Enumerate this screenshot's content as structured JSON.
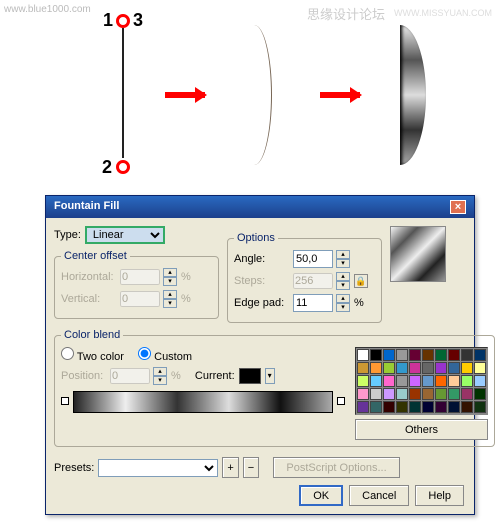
{
  "watermarks": {
    "left": "www.blue1000.com",
    "right_cn": "思缘设计论坛",
    "right_en": "WWW.MISSYUAN.COM"
  },
  "marks": {
    "one": "1",
    "two": "2",
    "three": "3"
  },
  "dialog": {
    "title": "Fountain Fill",
    "type_label": "Type:",
    "type_value": "Linear",
    "center_legend": "Center offset",
    "horiz": "Horizontal:",
    "horiz_v": "0",
    "vert": "Vertical:",
    "vert_v": "0",
    "pct": "%",
    "options_legend": "Options",
    "angle": "Angle:",
    "angle_v": "50,0",
    "steps": "Steps:",
    "steps_v": "256",
    "edge": "Edge pad:",
    "edge_v": "11",
    "blend_legend": "Color blend",
    "two_color": "Two color",
    "custom": "Custom",
    "position": "Position:",
    "position_v": "0",
    "current": "Current:",
    "others": "Others",
    "presets": "Presets:",
    "postscript": "PostScript Options...",
    "ok": "OK",
    "cancel": "Cancel",
    "help": "Help"
  }
}
